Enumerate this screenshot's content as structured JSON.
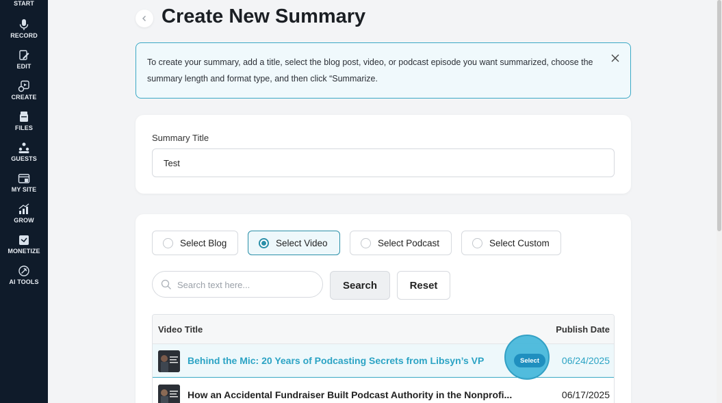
{
  "sidebar": {
    "items": [
      {
        "label": "START",
        "icon": "start-icon"
      },
      {
        "label": "RECORD",
        "icon": "microphone-icon"
      },
      {
        "label": "EDIT",
        "icon": "edit-icon"
      },
      {
        "label": "CREATE",
        "icon": "create-icon"
      },
      {
        "label": "FILES",
        "icon": "files-icon"
      },
      {
        "label": "GUESTS",
        "icon": "guests-icon"
      },
      {
        "label": "MY SITE",
        "icon": "site-icon"
      },
      {
        "label": "GROW",
        "icon": "grow-icon"
      },
      {
        "label": "MONETIZE",
        "icon": "monetize-icon"
      },
      {
        "label": "AI TOOLS",
        "icon": "ai-tools-icon"
      }
    ]
  },
  "header": {
    "title": "Create New Summary"
  },
  "banner": {
    "text": "To create your summary, add a title, select the blog post, video, or podcast episode you want summarized, choose the summary length and format type, and then click “Summarize."
  },
  "summary_form": {
    "title_label": "Summary Title",
    "title_value": "Test"
  },
  "source_select": {
    "options": [
      {
        "label": "Select Blog",
        "selected": false
      },
      {
        "label": "Select Video",
        "selected": true
      },
      {
        "label": "Select Podcast",
        "selected": false
      },
      {
        "label": "Select Custom",
        "selected": false
      }
    ],
    "search_placeholder": "Search text here...",
    "search_button": "Search",
    "reset_button": "Reset"
  },
  "table": {
    "col_title": "Video Title",
    "col_date": "Publish Date",
    "select_label": "Select",
    "rows": [
      {
        "title": "Behind the Mic: 20 Years of Podcasting Secrets from Libsyn’s VP",
        "date": "06/24/2025",
        "selected": true
      },
      {
        "title": "How an Accidental Fundraiser Built Podcast Authority in the Nonprofi...",
        "date": "06/17/2025",
        "selected": false
      }
    ]
  },
  "colors": {
    "accent": "#2ba3c4",
    "sidebar_bg": "#0f1b2a"
  }
}
